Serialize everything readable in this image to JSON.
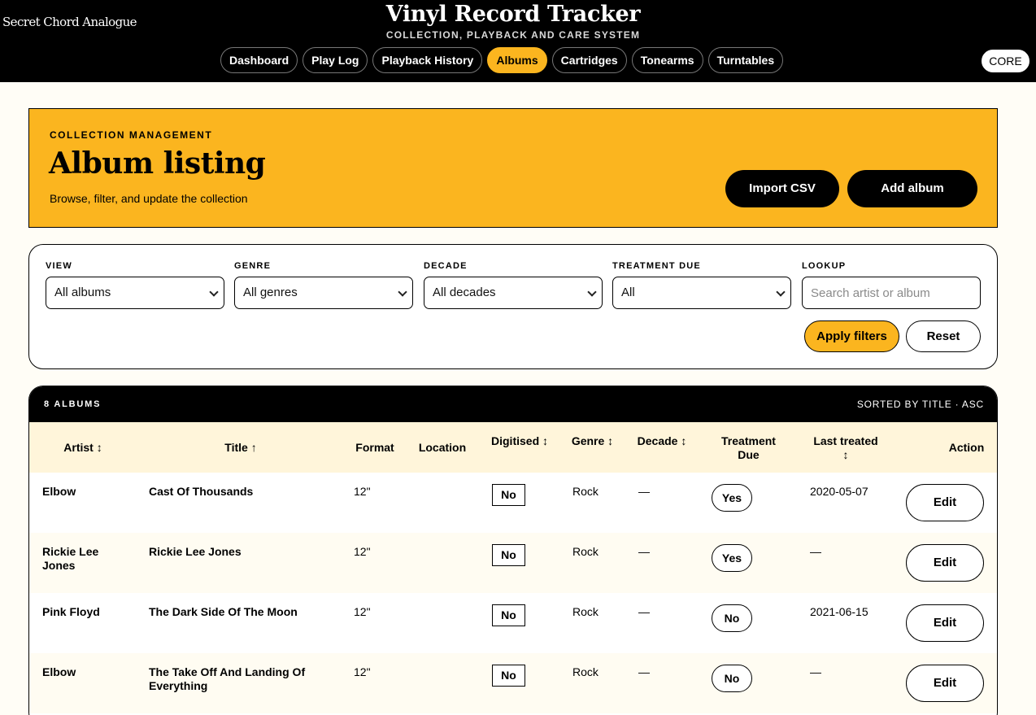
{
  "brand": "Secret Chord Analogue",
  "app": {
    "title": "Vinyl Record Tracker",
    "subtitle": "COLLECTION, PLAYBACK AND CARE SYSTEM"
  },
  "nav": {
    "tabs": [
      {
        "label": "Dashboard",
        "active": false
      },
      {
        "label": "Play Log",
        "active": false
      },
      {
        "label": "Playback History",
        "active": false
      },
      {
        "label": "Albums",
        "active": true
      },
      {
        "label": "Cartridges",
        "active": false
      },
      {
        "label": "Tonearms",
        "active": false
      },
      {
        "label": "Turntables",
        "active": false
      }
    ],
    "core_label": "CORE"
  },
  "hero": {
    "kicker": "COLLECTION MANAGEMENT",
    "title": "Album listing",
    "description": "Browse, filter, and update the collection",
    "import_label": "Import CSV",
    "add_label": "Add album"
  },
  "filters": {
    "view": {
      "label": "VIEW",
      "value": "All albums"
    },
    "genre": {
      "label": "GENRE",
      "value": "All genres"
    },
    "decade": {
      "label": "DECADE",
      "value": "All decades"
    },
    "treatment": {
      "label": "TREATMENT DUE",
      "value": "All"
    },
    "lookup": {
      "label": "LOOKUP",
      "value": "",
      "placeholder": "Search artist or album"
    },
    "apply_label": "Apply filters",
    "reset_label": "Reset"
  },
  "table": {
    "count": "8 ALBUMS",
    "sorted": "SORTED BY TITLE · ASC",
    "headers": {
      "artist": "Artist ↕",
      "title": "Title ↑",
      "format": "Format",
      "location": "Location",
      "digitised": "Digitised ↕",
      "genre": "Genre ↕",
      "decade": "Decade ↕",
      "treatment": "Treatment Due",
      "last_treated": "Last treated ↕",
      "action": "Action"
    },
    "rows": [
      {
        "artist": "Elbow",
        "title": "Cast Of Thousands",
        "format": "12\"",
        "location": "",
        "digitised": "No",
        "genre": "Rock",
        "decade": "—",
        "treatment_due": "Yes",
        "last_treated": "2020-05-07",
        "action": "Edit"
      },
      {
        "artist": "Rickie Lee Jones",
        "title": "Rickie Lee Jones",
        "format": "12\"",
        "location": "",
        "digitised": "No",
        "genre": "Rock",
        "decade": "—",
        "treatment_due": "Yes",
        "last_treated": "—",
        "action": "Edit"
      },
      {
        "artist": "Pink Floyd",
        "title": "The Dark Side Of The Moon",
        "format": "12\"",
        "location": "",
        "digitised": "No",
        "genre": "Rock",
        "decade": "—",
        "treatment_due": "No",
        "last_treated": "2021-06-15",
        "action": "Edit"
      },
      {
        "artist": "Elbow",
        "title": "The Take Off And Landing Of Everything",
        "format": "12\"",
        "location": "",
        "digitised": "No",
        "genre": "Rock",
        "decade": "—",
        "treatment_due": "No",
        "last_treated": "—",
        "action": "Edit"
      }
    ]
  },
  "colors": {
    "accent": "#fbb51f",
    "header_bg": "#000000",
    "table_head_bg": "#fff5da"
  }
}
